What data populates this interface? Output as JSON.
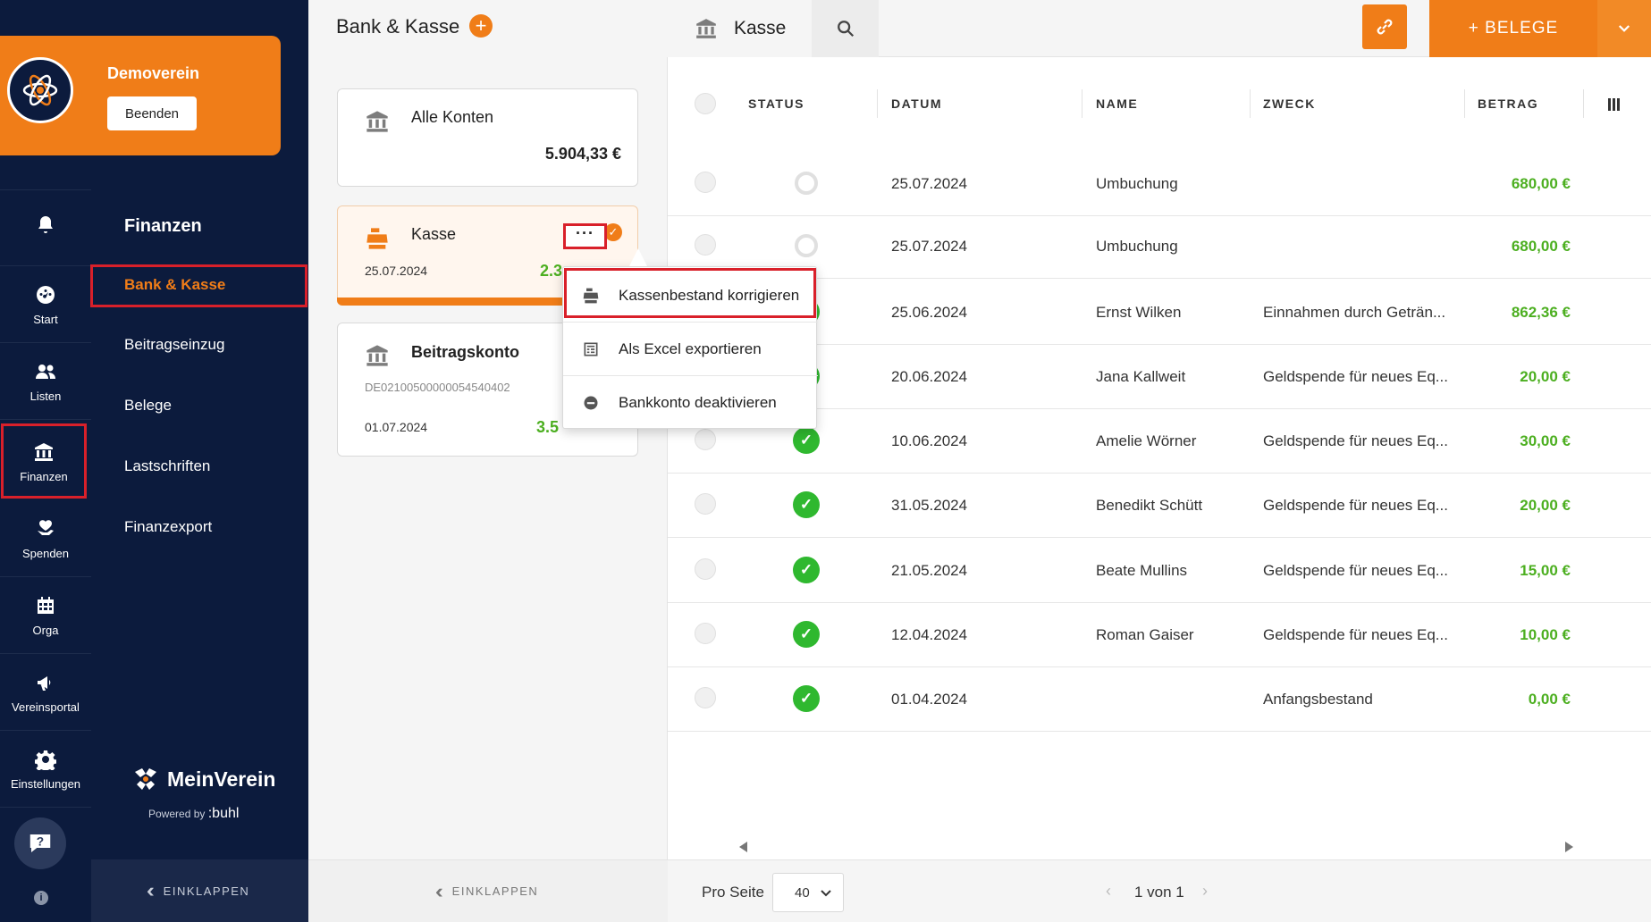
{
  "org": {
    "name": "Demoverein",
    "end_label": "Beenden"
  },
  "rail": {
    "items": [
      {
        "label": "",
        "icon": "bell-icon"
      },
      {
        "label": "Start",
        "icon": "dashboard-icon"
      },
      {
        "label": "Listen",
        "icon": "users-icon"
      },
      {
        "label": "Finanzen",
        "icon": "bank-icon"
      },
      {
        "label": "Spenden",
        "icon": "donation-icon"
      },
      {
        "label": "Orga",
        "icon": "calendar-icon"
      },
      {
        "label": "Vereinsportal",
        "icon": "megaphone-icon"
      },
      {
        "label": "Einstellungen",
        "icon": "gear-icon"
      }
    ]
  },
  "nav": {
    "title": "Finanzen",
    "links": [
      "Bank & Kasse",
      "Beitragseinzug",
      "Belege",
      "Lastschriften",
      "Finanzexport"
    ],
    "collapse": "EINKLAPPEN"
  },
  "brand": {
    "name": "MeinVerein",
    "powered": "Powered by",
    "powered_brand": ":buhl"
  },
  "accounts": {
    "header": "Bank & Kasse",
    "collapse": "EINKLAPPEN",
    "cards": [
      {
        "name": "Alle Konten",
        "amount": "5.904,33 €"
      },
      {
        "name": "Kasse",
        "date": "25.07.2024",
        "amount": "2.3"
      },
      {
        "name": "Beitragskonto",
        "iban": "DE02100500000054540402",
        "date": "01.07.2024",
        "amount": "3.5"
      }
    ]
  },
  "menu": {
    "items": [
      {
        "label": "Kassenbestand korrigieren",
        "icon": "cash-register-icon"
      },
      {
        "label": "Als Excel exportieren",
        "icon": "excel-icon"
      },
      {
        "label": "Bankkonto deaktivieren",
        "icon": "minus-circle-icon"
      }
    ]
  },
  "topbar": {
    "tab": "Kasse",
    "belege": "+ BELEGE"
  },
  "table": {
    "headers": [
      "STATUS",
      "DATUM",
      "NAME",
      "ZWECK",
      "BETRAG"
    ],
    "rows": [
      {
        "status": "open",
        "date": "25.07.2024",
        "name": "Umbuchung",
        "purpose": "",
        "amount": "680,00 €"
      },
      {
        "status": "open",
        "date": "25.07.2024",
        "name": "Umbuchung",
        "purpose": "",
        "amount": "680,00 €"
      },
      {
        "status": "ok",
        "date": "25.06.2024",
        "name": "Ernst Wilken",
        "purpose": "Einnahmen durch Geträn...",
        "amount": "862,36 €"
      },
      {
        "status": "ok",
        "date": "20.06.2024",
        "name": "Jana Kallweit",
        "purpose": "Geldspende für neues Eq...",
        "amount": "20,00 €"
      },
      {
        "status": "ok",
        "date": "10.06.2024",
        "name": "Amelie Wörner",
        "purpose": "Geldspende für neues Eq...",
        "amount": "30,00 €"
      },
      {
        "status": "ok",
        "date": "31.05.2024",
        "name": "Benedikt Schütt",
        "purpose": "Geldspende für neues Eq...",
        "amount": "20,00 €"
      },
      {
        "status": "ok",
        "date": "21.05.2024",
        "name": "Beate Mullins",
        "purpose": "Geldspende für neues Eq...",
        "amount": "15,00 €"
      },
      {
        "status": "ok",
        "date": "12.04.2024",
        "name": "Roman Gaiser",
        "purpose": "Geldspende für neues Eq...",
        "amount": "10,00 €"
      },
      {
        "status": "ok",
        "date": "01.04.2024",
        "name": "",
        "purpose": "Anfangsbestand",
        "amount": "0,00 €"
      }
    ]
  },
  "footer": {
    "per_page_label": "Pro Seite",
    "per_page_value": "40",
    "pager": "1 von 1"
  },
  "colors": {
    "accent": "#f07d18",
    "navy": "#0c1b3d",
    "positive": "#4caf20",
    "highlight": "#d9202a"
  }
}
